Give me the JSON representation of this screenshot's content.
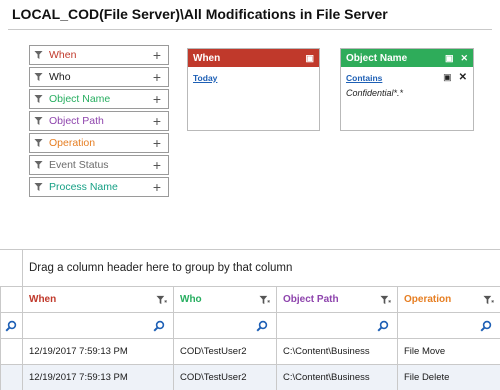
{
  "header": {
    "title": "LOCAL_COD(File Server)\\All Modifications in File Server"
  },
  "fields": [
    {
      "label": "When",
      "color": "#c0392b"
    },
    {
      "label": "Who",
      "color": "#1a1a1a"
    },
    {
      "label": "Object Name",
      "color": "#27ae60"
    },
    {
      "label": "Object Path",
      "color": "#8e44ad"
    },
    {
      "label": "Operation",
      "color": "#e67e22"
    },
    {
      "label": "Event Status",
      "color": "#6b6b6b"
    },
    {
      "label": "Process Name",
      "color": "#16a085"
    }
  ],
  "cards": {
    "when": {
      "title": "When",
      "color": "#c0392b",
      "link": "Today"
    },
    "object_name": {
      "title": "Object Name",
      "color": "#2eac5a",
      "link": "Contains",
      "value": "Confidential*.*"
    }
  },
  "grid": {
    "group_hint": "Drag a column header here to group by that column",
    "columns": [
      {
        "label": "When",
        "color": "#c0392b"
      },
      {
        "label": "Who",
        "color": "#27ae60"
      },
      {
        "label": "Object Path",
        "color": "#8e44ad"
      },
      {
        "label": "Operation",
        "color": "#e67e22"
      }
    ],
    "rows": [
      [
        "12/19/2017 7:59:13 PM",
        "COD\\TestUser2",
        "C:\\Content\\Business",
        "File Move"
      ],
      [
        "12/19/2017 7:59:13 PM",
        "COD\\TestUser2",
        "C:\\Content\\Business",
        "File Delete"
      ]
    ]
  },
  "icons": {
    "funnel": "funnel-icon",
    "plus": "plus-icon",
    "search": "search-icon",
    "close": "close-icon",
    "window": "window-icon"
  }
}
